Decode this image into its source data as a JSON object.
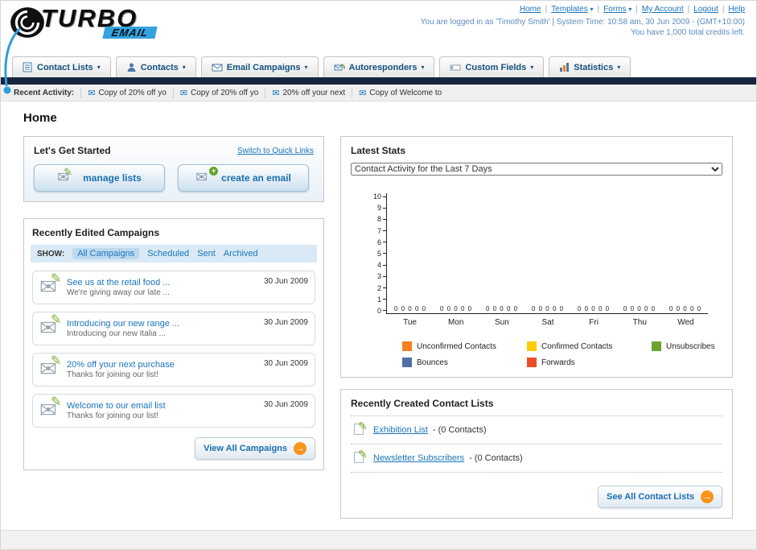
{
  "header": {
    "logo_main": "TURBO",
    "logo_sub": "EMAIL",
    "top_links": [
      "Home",
      "Templates",
      "Forms",
      "My Account",
      "Logout",
      "Help"
    ],
    "login_info": "You are logged in as 'Timothy Smith' | System Time: 10:58 am, 30 Jun 2009 - (GMT+10:00)",
    "credits_info": "You have 1,000 total credits left."
  },
  "icons": {
    "caret": "▾",
    "envelope": "✉",
    "pencil": "✎",
    "arrow": "→",
    "plus": "+"
  },
  "nav_tabs": [
    {
      "label": "Contact Lists"
    },
    {
      "label": "Contacts"
    },
    {
      "label": "Email Campaigns"
    },
    {
      "label": "Autoresponders"
    },
    {
      "label": "Custom Fields"
    },
    {
      "label": "Statistics"
    }
  ],
  "recent_activity": {
    "label": "Recent Activity:",
    "items": [
      "Copy of 20% off yo",
      "Copy of 20% off yo",
      "20% off your next",
      "Copy of Welcome to"
    ]
  },
  "page_title": "Home",
  "get_started": {
    "title": "Let's Get Started",
    "switch_link": "Switch to Quick Links",
    "manage_lists_label": "manage lists",
    "create_email_label": "create an email"
  },
  "campaigns": {
    "title": "Recently Edited Campaigns",
    "show_label": "SHOW:",
    "filters": [
      "All Campaigns",
      "Scheduled",
      "Sent",
      "Archived"
    ],
    "active_filter": "All Campaigns",
    "items": [
      {
        "title": "See us at the retail food ...",
        "subtitle": "We're giving away our late ...",
        "date": "30 Jun 2009"
      },
      {
        "title": "Introducing our new range ...",
        "subtitle": "Introducing our new Italia ...",
        "date": "30 Jun 2009"
      },
      {
        "title": "20% off your next purchase",
        "subtitle": "Thanks for joining our list!",
        "date": "30 Jun 2009"
      },
      {
        "title": "Welcome to our email list",
        "subtitle": "Thanks for joining our list!",
        "date": "30 Jun 2009"
      }
    ],
    "view_all_label": "View All Campaigns"
  },
  "latest_stats": {
    "title": "Latest Stats",
    "dropdown_value": "Contact Activity for the Last 7 Days",
    "yticks": [
      "10",
      "9",
      "8",
      "7",
      "6",
      "5",
      "4",
      "3",
      "2",
      "1",
      "0"
    ],
    "zeros_display": "0 0 0 0 0"
  },
  "chart_data": {
    "type": "bar",
    "title": "Contact Activity for the Last 7 Days",
    "categories": [
      "Tue",
      "Mon",
      "Sun",
      "Sat",
      "Fri",
      "Thu",
      "Wed"
    ],
    "series": [
      {
        "name": "Unconfirmed Contacts",
        "color": "#f5821f",
        "values": [
          0,
          0,
          0,
          0,
          0,
          0,
          0
        ]
      },
      {
        "name": "Confirmed Contacts",
        "color": "#ffcc00",
        "values": [
          0,
          0,
          0,
          0,
          0,
          0,
          0
        ]
      },
      {
        "name": "Unsubscribes",
        "color": "#69a52c",
        "values": [
          0,
          0,
          0,
          0,
          0,
          0,
          0
        ]
      },
      {
        "name": "Bounces",
        "color": "#4f6fa5",
        "values": [
          0,
          0,
          0,
          0,
          0,
          0,
          0
        ]
      },
      {
        "name": "Forwards",
        "color": "#e8502a",
        "values": [
          0,
          0,
          0,
          0,
          0,
          0,
          0
        ]
      }
    ],
    "ylim": [
      0,
      10
    ],
    "grid": false,
    "legend_position": "bottom"
  },
  "contact_lists": {
    "title": "Recently Created Contact Lists",
    "items": [
      {
        "name": "Exhibition List",
        "detail": " - (0 Contacts)"
      },
      {
        "name": "Newsletter Subscribers",
        "detail": " - (0 Contacts)"
      }
    ],
    "see_all_label": "See All Contact Lists"
  }
}
